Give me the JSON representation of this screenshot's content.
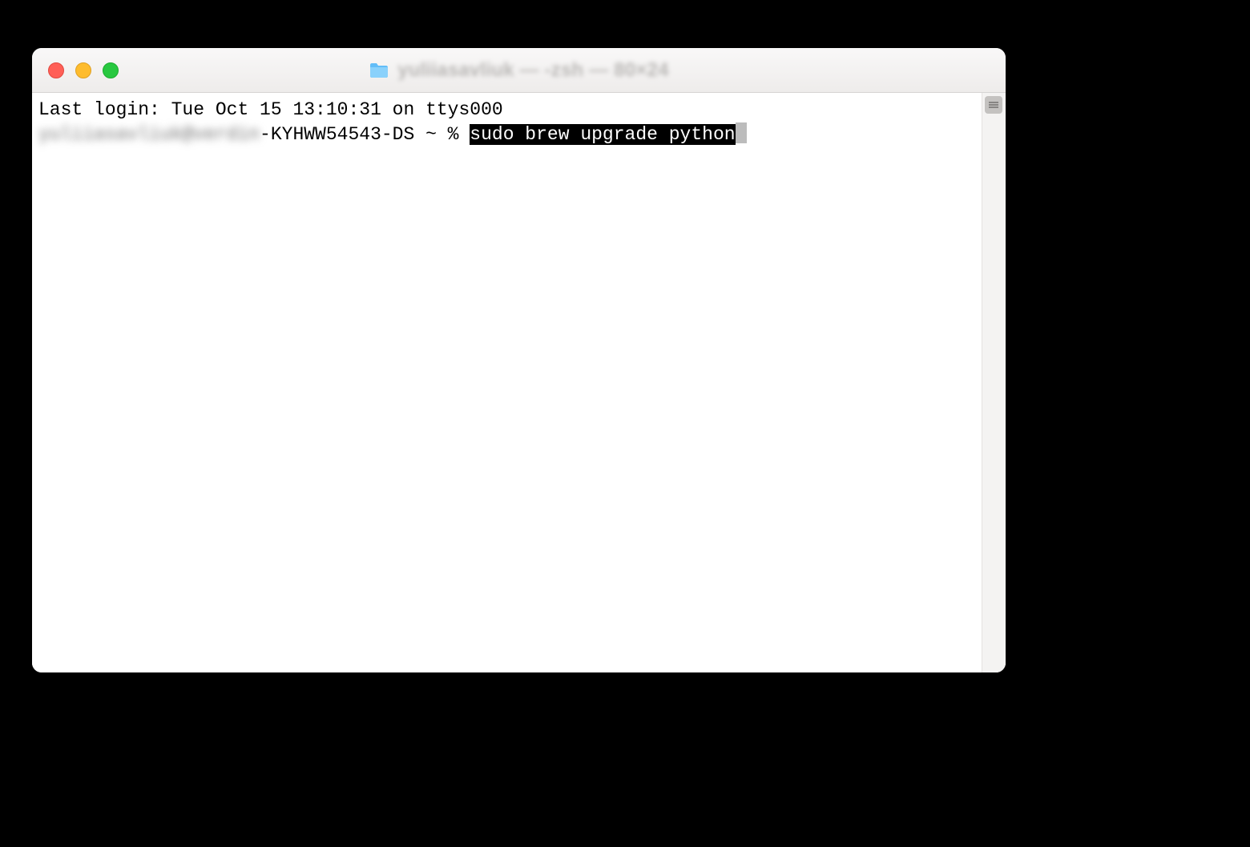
{
  "window": {
    "title": "yuliiasavliuk — -zsh — 80×24"
  },
  "terminal": {
    "last_login": "Last login: Tue Oct 15 13:10:31 on ttys000",
    "prompt_user_blurred": "yuliiasavliuk@verdin",
    "prompt_host_suffix": "-KYHWW54543-DS ~ % ",
    "command_selected": "sudo brew upgrade python"
  }
}
